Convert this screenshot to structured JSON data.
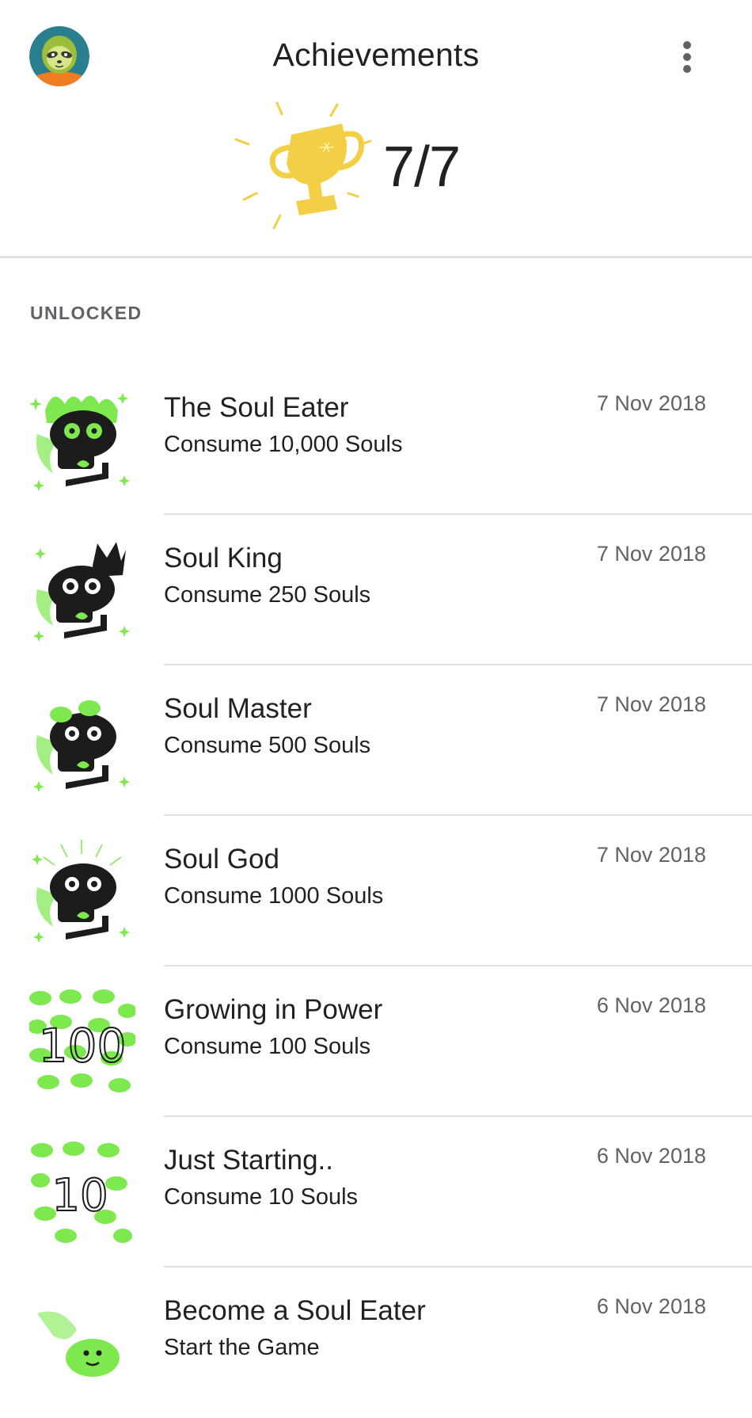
{
  "header": {
    "title": "Achievements",
    "avatar_icon": "sloth-avatar-icon",
    "menu_icon": "more-vert-icon",
    "trophy_icon": "trophy-icon",
    "score": "7/7"
  },
  "section": {
    "label": "UNLOCKED"
  },
  "achievements": [
    {
      "title": "The Soul Eater",
      "description": "Consume 10,000 Souls",
      "date": "7 Nov 2018",
      "icon": "skull-flame-icon"
    },
    {
      "title": "Soul King",
      "description": "Consume 250 Souls",
      "date": "7 Nov 2018",
      "icon": "skull-crown-icon"
    },
    {
      "title": "Soul Master",
      "description": "Consume 500 Souls",
      "date": "7 Nov 2018",
      "icon": "skull-souls-icon"
    },
    {
      "title": "Soul God",
      "description": "Consume 1000 Souls",
      "date": "7 Nov 2018",
      "icon": "skull-rays-icon"
    },
    {
      "title": "Growing in Power",
      "description": "Consume 100 Souls",
      "date": "6 Nov 2018",
      "icon": "souls-100-icon",
      "badge_text": "100"
    },
    {
      "title": "Just Starting..",
      "description": "Consume 10 Souls",
      "date": "6 Nov 2018",
      "icon": "souls-10-icon",
      "badge_text": "10"
    },
    {
      "title": "Become a Soul Eater",
      "description": "Start the Game",
      "date": "6 Nov 2018",
      "icon": "single-soul-icon"
    }
  ],
  "colors": {
    "soul_green": "#7ee84f",
    "skull_black": "#1c1c1c",
    "trophy_gold": "#f4cf45",
    "divider": "#e0e0e0",
    "secondary_text": "#5f6368"
  }
}
